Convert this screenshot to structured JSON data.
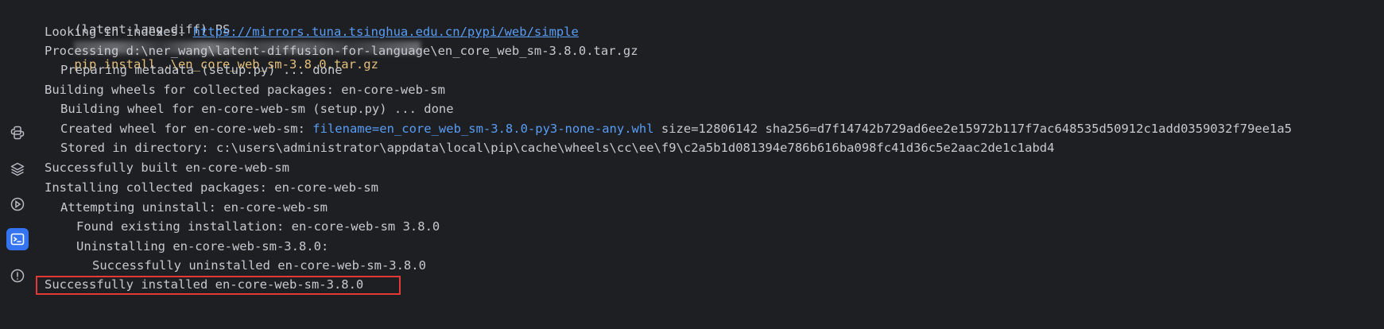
{
  "sidebar": {
    "icons": [
      "python-icon",
      "layers-icon",
      "services-icon",
      "terminal-icon",
      "problems-icon"
    ]
  },
  "terminal": {
    "prompt": "(latent-lang-diff) PS",
    "command": "pip install .\\en_core_web_sm-3.8.0.tar.gz",
    "looking_in_prefix": "Looking in indexes: ",
    "index_url": "https://mirrors.tuna.tsinghua.edu.cn/pypi/web/simple",
    "processing": "Processing d:\\ner_wang\\latent-diffusion-for-language\\en_core_web_sm-3.8.0.tar.gz",
    "preparing": "Preparing metadata (setup.py) ... done",
    "building_wheels": "Building wheels for collected packages: en-core-web-sm",
    "building_wheel": "Building wheel for en-core-web-sm (setup.py) ... done",
    "created_prefix": "Created wheel for en-core-web-sm: ",
    "created_filename": "filename=en_core_web_sm-3.8.0-py3-none-any.whl",
    "created_size": " size=12806142 sha256=d7f14742b729ad6ee2e15972b117f7ac648535d50912c1add0359032f79ee1a5",
    "stored": "Stored in directory: c:\\users\\administrator\\appdata\\local\\pip\\cache\\wheels\\cc\\ee\\f9\\c2a5b1d081394e786b616ba098fc41d36c5e2aac2de1c1abd4",
    "built": "Successfully built en-core-web-sm",
    "installing": "Installing collected packages: en-core-web-sm",
    "attempting": "Attempting uninstall: en-core-web-sm",
    "found": "Found existing installation: en-core-web-sm 3.8.0",
    "uninstalling": "Uninstalling en-core-web-sm-3.8.0:",
    "uninstalled": "Successfully uninstalled en-core-web-sm-3.8.0",
    "installed": "Successfully installed en-core-web-sm-3.8.0"
  },
  "colors": {
    "background": "#1e1f22",
    "text": "#c5c9d0",
    "command": "#e5c07b",
    "link": "#589df6",
    "highlight_border": "#e53935",
    "active_icon_bg": "#3574f0"
  }
}
